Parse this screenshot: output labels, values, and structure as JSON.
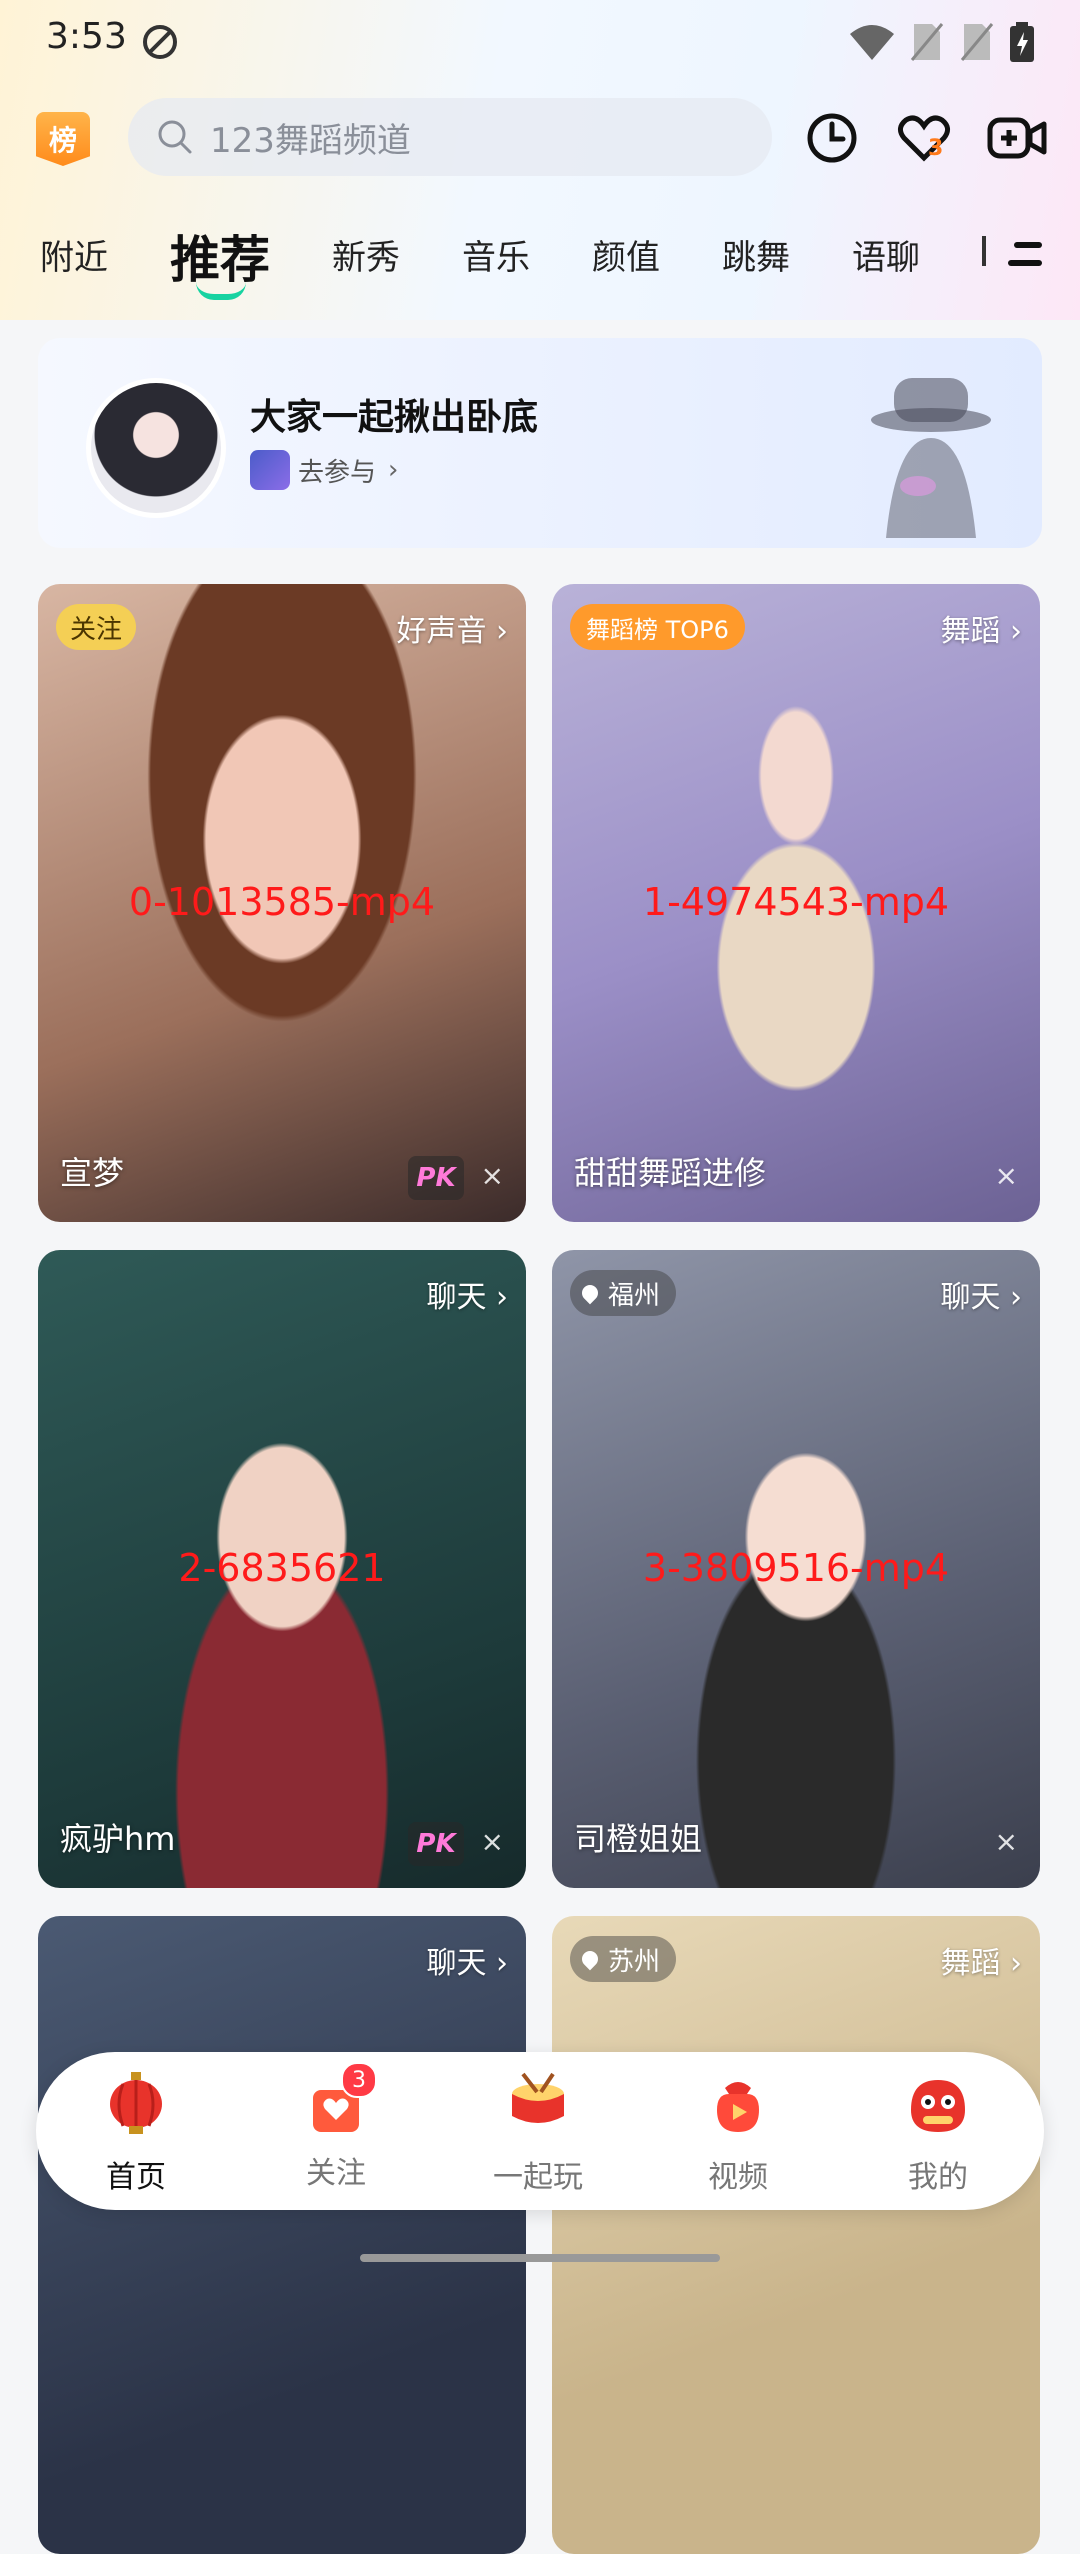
{
  "status_bar": {
    "time": "3:53"
  },
  "header": {
    "rank_badge": "榜",
    "search_placeholder": "123舞蹈频道",
    "favorites_badge": "3"
  },
  "tabs": [
    "附近",
    "推荐",
    "新秀",
    "音乐",
    "颜值",
    "跳舞",
    "语聊"
  ],
  "active_tab": "推荐",
  "banner": {
    "title": "大家一起揪出卧底",
    "subtitle": "去参与"
  },
  "cards": [
    {
      "tag": "关注",
      "category": "好声音",
      "media": "0-1013585-mp4",
      "name": "宣梦",
      "pk": "PK"
    },
    {
      "tag": "舞蹈榜 TOP6",
      "category": "舞蹈",
      "media": "1-4974543-mp4",
      "name": "甜甜舞蹈进修"
    },
    {
      "category": "聊天",
      "media": "2-6835621",
      "name": "疯驴hm",
      "pk": "PK"
    },
    {
      "location": "福州",
      "category": "聊天",
      "media": "3-3809516-mp4",
      "name": "司橙姐姐"
    },
    {
      "category": "聊天"
    },
    {
      "location": "苏州",
      "category": "舞蹈"
    }
  ],
  "close_glyph": "×",
  "chevron_glyph": "›",
  "bottom_nav": {
    "items": [
      "首页",
      "关注",
      "一起玩",
      "视频",
      "我的"
    ],
    "follow_badge": "3",
    "active": "首页"
  },
  "colors": {
    "accent": "#18d3a1",
    "rank_orange": "#ff9a2b",
    "badge_red": "#ff3a45"
  }
}
